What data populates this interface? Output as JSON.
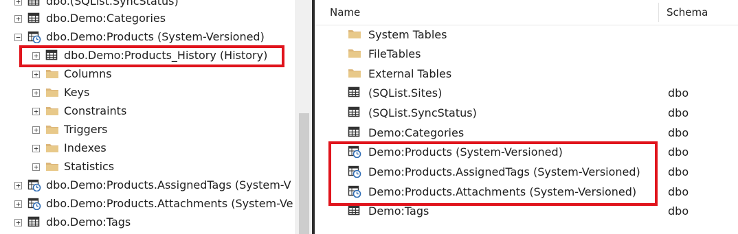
{
  "tree": {
    "items": [
      {
        "label": "dbo.(SQList.SyncStatus)",
        "expander": "+",
        "icon": "table-icon"
      },
      {
        "label": "dbo.Demo:Categories",
        "expander": "+",
        "icon": "table-icon"
      },
      {
        "label": "dbo.Demo:Products (System-Versioned)",
        "expander": "−",
        "icon": "temporal-table-icon"
      },
      {
        "label": "dbo.Demo:Products_History (History)",
        "expander": "+",
        "icon": "table-icon"
      },
      {
        "label": "Columns",
        "expander": "+",
        "icon": "folder-icon"
      },
      {
        "label": "Keys",
        "expander": "+",
        "icon": "folder-icon"
      },
      {
        "label": "Constraints",
        "expander": "+",
        "icon": "folder-icon"
      },
      {
        "label": "Triggers",
        "expander": "+",
        "icon": "folder-icon"
      },
      {
        "label": "Indexes",
        "expander": "+",
        "icon": "folder-icon"
      },
      {
        "label": "Statistics",
        "expander": "+",
        "icon": "folder-icon"
      },
      {
        "label": "dbo.Demo:Products.AssignedTags (System-V",
        "expander": "+",
        "icon": "temporal-table-icon"
      },
      {
        "label": "dbo.Demo:Products.Attachments (System-Ve",
        "expander": "+",
        "icon": "temporal-table-icon"
      },
      {
        "label": "dbo.Demo:Tags",
        "expander": "+",
        "icon": "table-icon"
      }
    ]
  },
  "list": {
    "columns": {
      "name": "Name",
      "schema": "Schema"
    },
    "rows": [
      {
        "name": "System Tables",
        "schema": "",
        "icon": "folder-icon"
      },
      {
        "name": "FileTables",
        "schema": "",
        "icon": "folder-icon"
      },
      {
        "name": "External Tables",
        "schema": "",
        "icon": "folder-icon"
      },
      {
        "name": "(SQList.Sites)",
        "schema": "dbo",
        "icon": "table-icon"
      },
      {
        "name": "(SQList.SyncStatus)",
        "schema": "dbo",
        "icon": "table-icon"
      },
      {
        "name": "Demo:Categories",
        "schema": "dbo",
        "icon": "table-icon"
      },
      {
        "name": "Demo:Products (System-Versioned)",
        "schema": "dbo",
        "icon": "temporal-table-icon"
      },
      {
        "name": "Demo:Products.AssignedTags (System-Versioned)",
        "schema": "dbo",
        "icon": "temporal-table-icon"
      },
      {
        "name": "Demo:Products.Attachments (System-Versioned)",
        "schema": "dbo",
        "icon": "temporal-table-icon"
      },
      {
        "name": "Demo:Tags",
        "schema": "dbo",
        "icon": "table-icon"
      }
    ]
  },
  "colors": {
    "highlight": "#e0141c",
    "folder": "#dcb67a",
    "splitter": "#2b2b2b"
  }
}
